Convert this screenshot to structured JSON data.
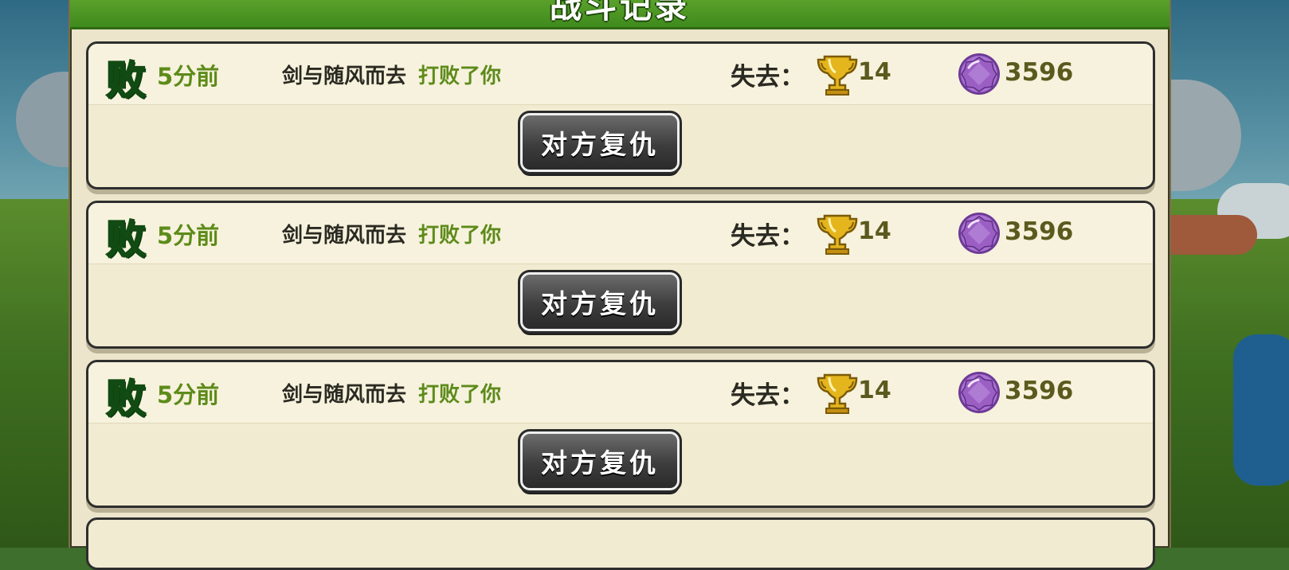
{
  "header": {
    "title": "战斗记录"
  },
  "records": [
    {
      "badge": "败",
      "time": "5分前",
      "opponent": "剑与随风而去",
      "result_text": "打败了你",
      "lose_label": "失去：",
      "trophy_icon": "trophy-icon",
      "trophies": "14",
      "gem_icon": "purple-gem-icon",
      "gems": "3596",
      "button_label": "对方复仇"
    },
    {
      "badge": "败",
      "time": "5分前",
      "opponent": "剑与随风而去",
      "result_text": "打败了你",
      "lose_label": "失去：",
      "trophy_icon": "trophy-icon",
      "trophies": "14",
      "gem_icon": "purple-gem-icon",
      "gems": "3596",
      "button_label": "对方复仇"
    },
    {
      "badge": "败",
      "time": "5分前",
      "opponent": "剑与随风而去",
      "result_text": "打败了你",
      "lose_label": "失去：",
      "trophy_icon": "trophy-icon",
      "trophies": "14",
      "gem_icon": "purple-gem-icon",
      "gems": "3596",
      "button_label": "对方复仇"
    }
  ],
  "colors": {
    "header_green": "#4a9424",
    "panel_beige": "#ece5cb",
    "badge_green": "#3a9a2a",
    "time_green": "#5d8b1a",
    "button_dark": "#3d3d3d",
    "gem_purple": "#9b5fc4",
    "trophy_gold": "#e5b51d"
  }
}
